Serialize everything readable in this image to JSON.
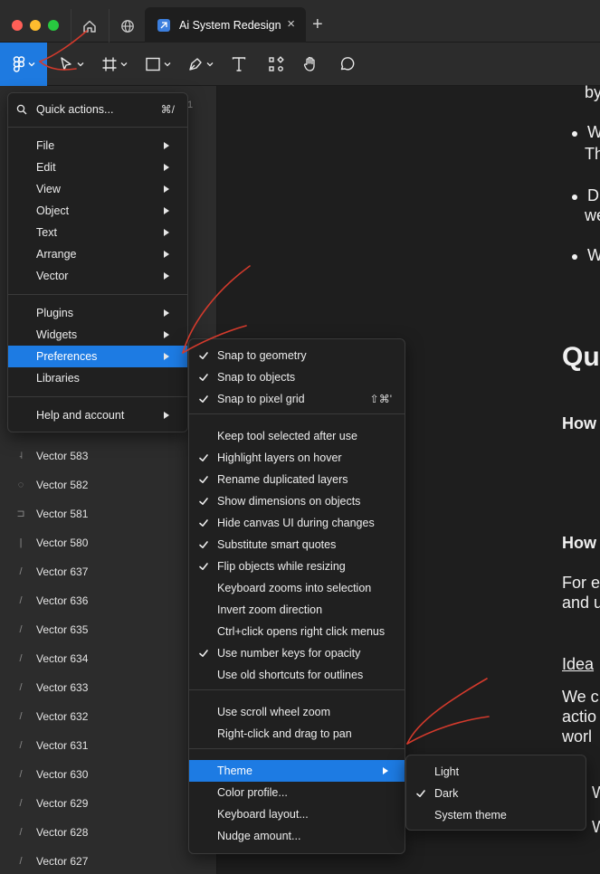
{
  "tab": {
    "title": "Ai System Redesign",
    "close": "×",
    "new_tab": "+"
  },
  "sidebar": {
    "page_number": "1",
    "layers": [
      "Vector 583",
      "Vector 582",
      "Vector 581",
      "Vector 580",
      "Vector 637",
      "Vector 636",
      "Vector 635",
      "Vector 634",
      "Vector 633",
      "Vector 632",
      "Vector 631",
      "Vector 630",
      "Vector 629",
      "Vector 628",
      "Vector 627"
    ]
  },
  "main_menu": {
    "search": {
      "label": "Quick actions...",
      "shortcut": "⌘/"
    },
    "groups": [
      [
        "File",
        "Edit",
        "View",
        "Object",
        "Text",
        "Arrange",
        "Vector"
      ],
      [
        "Plugins",
        "Widgets",
        "Preferences",
        "Libraries"
      ],
      [
        "Help and account"
      ]
    ],
    "active": "Preferences"
  },
  "preferences_menu": {
    "groups": [
      [
        {
          "label": "Snap to geometry",
          "checked": true
        },
        {
          "label": "Snap to objects",
          "checked": true
        },
        {
          "label": "Snap to pixel grid",
          "checked": true,
          "shortcut": "⇧⌘'"
        }
      ],
      [
        {
          "label": "Keep tool selected after use",
          "checked": false
        },
        {
          "label": "Highlight layers on hover",
          "checked": true
        },
        {
          "label": "Rename duplicated layers",
          "checked": true
        },
        {
          "label": "Show dimensions on objects",
          "checked": true
        },
        {
          "label": "Hide canvas UI during changes",
          "checked": true
        },
        {
          "label": "Substitute smart quotes",
          "checked": true
        },
        {
          "label": "Flip objects while resizing",
          "checked": true
        },
        {
          "label": "Keyboard zooms into selection",
          "checked": false
        },
        {
          "label": "Invert zoom direction",
          "checked": false
        },
        {
          "label": "Ctrl+click opens right click menus",
          "checked": false
        },
        {
          "label": "Use number keys for opacity",
          "checked": true
        },
        {
          "label": "Use old shortcuts for outlines",
          "checked": false
        }
      ],
      [
        {
          "label": "Use scroll wheel zoom",
          "checked": false
        },
        {
          "label": "Right-click and drag to pan",
          "checked": false
        }
      ],
      [
        {
          "label": "Theme",
          "checked": false,
          "submenu": true
        },
        {
          "label": "Color profile...",
          "checked": false
        },
        {
          "label": "Keyboard layout...",
          "checked": false
        },
        {
          "label": "Nudge amount...",
          "checked": false
        }
      ]
    ],
    "active": "Theme"
  },
  "theme_menu": {
    "items": [
      {
        "label": "Light",
        "checked": false
      },
      {
        "label": "Dark",
        "checked": true
      },
      {
        "label": "System theme",
        "checked": false
      }
    ]
  },
  "canvas": {
    "fragments": [
      {
        "text": "by",
        "style": "p"
      },
      {
        "text": "W",
        "style": "p",
        "bullet": true
      },
      {
        "text": "Th",
        "style": "p"
      },
      {
        "text": "D",
        "style": "p",
        "bullet": true
      },
      {
        "text": "we",
        "style": "p"
      },
      {
        "text": "W",
        "style": "p",
        "bullet": true
      },
      {
        "text": "Qu",
        "style": "h2"
      },
      {
        "text": "How",
        "style": "h3"
      },
      {
        "text": "How",
        "style": "h3"
      },
      {
        "text": "For e",
        "style": "p"
      },
      {
        "text": "and u",
        "style": "p"
      },
      {
        "text": "Idea",
        "style": "link"
      },
      {
        "text": "We c",
        "style": "p"
      },
      {
        "text": "actio",
        "style": "p"
      },
      {
        "text": "worl",
        "style": "p"
      },
      {
        "text": "W",
        "style": "p"
      },
      {
        "text": "W",
        "style": "p"
      }
    ]
  },
  "colors": {
    "accent": "#1d7be3",
    "menu_bg": "#202020",
    "panel_bg": "#2c2c2c",
    "annotation": "#d33a2c"
  }
}
